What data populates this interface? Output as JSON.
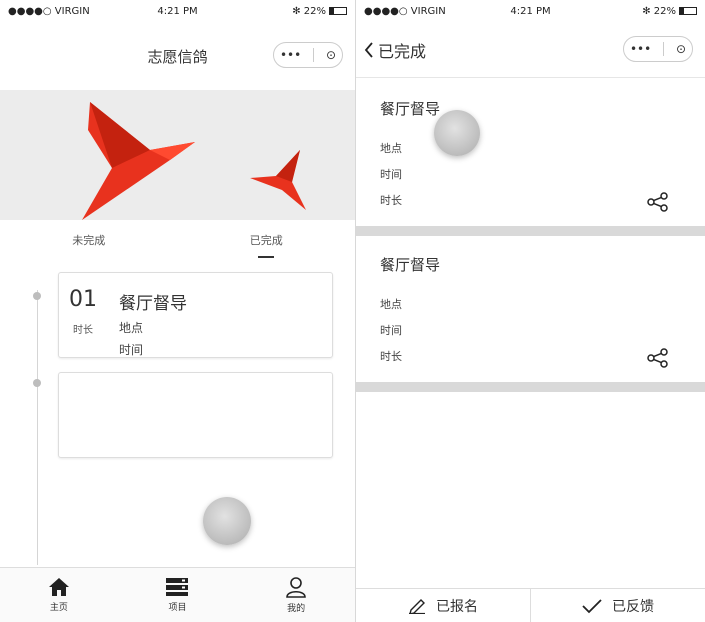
{
  "status_bar": {
    "carrier": "●●●●○ VIRGIN",
    "time": "4:21 PM",
    "battery": "22%"
  },
  "left": {
    "title": "志愿信鸽",
    "capsule": {
      "more": "•••",
      "close": "⊙"
    },
    "tabs": [
      {
        "label": "未完成"
      },
      {
        "label": "已完成"
      }
    ],
    "card": {
      "number": "01",
      "duration_label": "时长",
      "title": "餐厅督导",
      "place_label": "地点",
      "time_label": "时间"
    },
    "tabbar": [
      {
        "label": "主页",
        "icon": "home-icon"
      },
      {
        "label": "项目",
        "icon": "server-icon"
      },
      {
        "label": "我的",
        "icon": "user-icon"
      }
    ]
  },
  "right": {
    "back_title": "已完成",
    "capsule": {
      "more": "•••",
      "close": "⊙"
    },
    "items": [
      {
        "title": "餐厅督导",
        "place_label": "地点",
        "time_label": "时间",
        "duration_label": "时长"
      },
      {
        "title": "餐厅督导",
        "place_label": "地点",
        "time_label": "时间",
        "duration_label": "时长"
      }
    ],
    "bottom_buttons": [
      {
        "label": "已报名",
        "icon": "pen-icon"
      },
      {
        "label": "已反馈",
        "icon": "check-icon"
      }
    ]
  },
  "colors": {
    "accent_red": "#e8321e",
    "divider_gray": "#d9d9d9"
  }
}
